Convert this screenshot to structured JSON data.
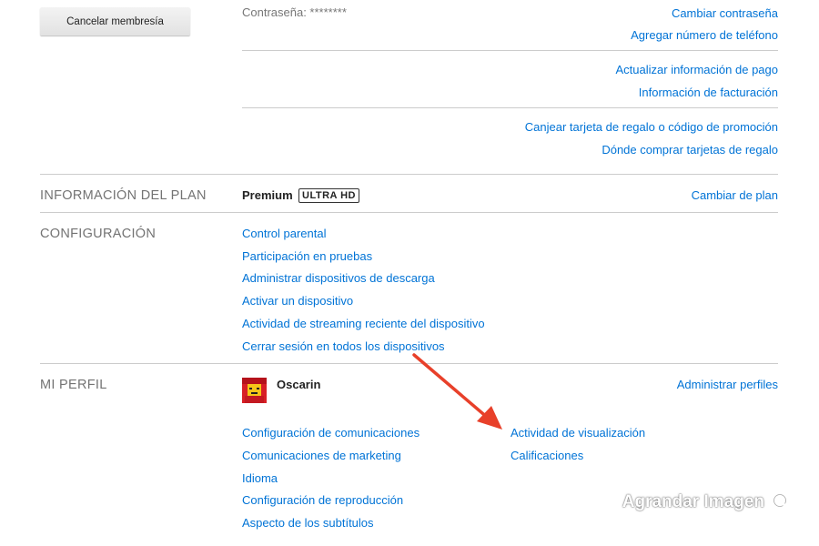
{
  "membership": {
    "cancel_button": "Cancelar membresía",
    "password_label": "Contraseña: ********",
    "change_password": "Cambiar contraseña",
    "add_phone": "Agregar número de teléfono",
    "update_payment": "Actualizar información de pago",
    "billing_info": "Información de facturación",
    "redeem_gift": "Canjear tarjeta de regalo o código de promoción",
    "where_buy_gift": "Dónde comprar tarjetas de regalo"
  },
  "plan": {
    "title": "INFORMACIÓN DEL PLAN",
    "name": "Premium",
    "badge": "ULTRA HD",
    "change_plan": "Cambiar de plan"
  },
  "settings": {
    "title": "CONFIGURACIÓN",
    "items": [
      "Control parental",
      "Participación en pruebas",
      "Administrar dispositivos de descarga",
      "Activar un dispositivo",
      "Actividad de streaming reciente del dispositivo",
      "Cerrar sesión en todos los dispositivos"
    ]
  },
  "profile": {
    "title": "MI PERFIL",
    "name": "Oscarin",
    "manage_profiles": "Administrar perfiles",
    "left_links": [
      "Configuración de comunicaciones",
      "Comunicaciones de marketing",
      "Idioma",
      "Configuración de reproducción",
      "Aspecto de los subtítulos"
    ],
    "right_links": [
      "Actividad de visualización",
      "Calificaciones"
    ]
  },
  "watermark": "Agrandar Imagen",
  "colors": {
    "link": "#0073d6",
    "annotation_arrow": "#e8402a",
    "divider": "#cccccc"
  }
}
